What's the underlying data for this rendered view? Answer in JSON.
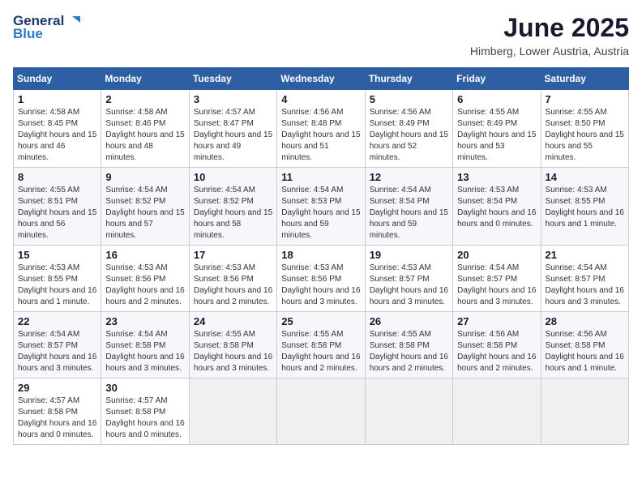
{
  "header": {
    "logo_line1": "General",
    "logo_line2": "Blue",
    "month_title": "June 2025",
    "subtitle": "Himberg, Lower Austria, Austria"
  },
  "weekdays": [
    "Sunday",
    "Monday",
    "Tuesday",
    "Wednesday",
    "Thursday",
    "Friday",
    "Saturday"
  ],
  "weeks": [
    [
      {
        "day": "1",
        "sunrise": "4:58 AM",
        "sunset": "8:45 PM",
        "daylight": "15 hours and 46 minutes."
      },
      {
        "day": "2",
        "sunrise": "4:58 AM",
        "sunset": "8:46 PM",
        "daylight": "15 hours and 48 minutes."
      },
      {
        "day": "3",
        "sunrise": "4:57 AM",
        "sunset": "8:47 PM",
        "daylight": "15 hours and 49 minutes."
      },
      {
        "day": "4",
        "sunrise": "4:56 AM",
        "sunset": "8:48 PM",
        "daylight": "15 hours and 51 minutes."
      },
      {
        "day": "5",
        "sunrise": "4:56 AM",
        "sunset": "8:49 PM",
        "daylight": "15 hours and 52 minutes."
      },
      {
        "day": "6",
        "sunrise": "4:55 AM",
        "sunset": "8:49 PM",
        "daylight": "15 hours and 53 minutes."
      },
      {
        "day": "7",
        "sunrise": "4:55 AM",
        "sunset": "8:50 PM",
        "daylight": "15 hours and 55 minutes."
      }
    ],
    [
      {
        "day": "8",
        "sunrise": "4:55 AM",
        "sunset": "8:51 PM",
        "daylight": "15 hours and 56 minutes."
      },
      {
        "day": "9",
        "sunrise": "4:54 AM",
        "sunset": "8:52 PM",
        "daylight": "15 hours and 57 minutes."
      },
      {
        "day": "10",
        "sunrise": "4:54 AM",
        "sunset": "8:52 PM",
        "daylight": "15 hours and 58 minutes."
      },
      {
        "day": "11",
        "sunrise": "4:54 AM",
        "sunset": "8:53 PM",
        "daylight": "15 hours and 59 minutes."
      },
      {
        "day": "12",
        "sunrise": "4:54 AM",
        "sunset": "8:54 PM",
        "daylight": "15 hours and 59 minutes."
      },
      {
        "day": "13",
        "sunrise": "4:53 AM",
        "sunset": "8:54 PM",
        "daylight": "16 hours and 0 minutes."
      },
      {
        "day": "14",
        "sunrise": "4:53 AM",
        "sunset": "8:55 PM",
        "daylight": "16 hours and 1 minute."
      }
    ],
    [
      {
        "day": "15",
        "sunrise": "4:53 AM",
        "sunset": "8:55 PM",
        "daylight": "16 hours and 1 minute."
      },
      {
        "day": "16",
        "sunrise": "4:53 AM",
        "sunset": "8:56 PM",
        "daylight": "16 hours and 2 minutes."
      },
      {
        "day": "17",
        "sunrise": "4:53 AM",
        "sunset": "8:56 PM",
        "daylight": "16 hours and 2 minutes."
      },
      {
        "day": "18",
        "sunrise": "4:53 AM",
        "sunset": "8:56 PM",
        "daylight": "16 hours and 3 minutes."
      },
      {
        "day": "19",
        "sunrise": "4:53 AM",
        "sunset": "8:57 PM",
        "daylight": "16 hours and 3 minutes."
      },
      {
        "day": "20",
        "sunrise": "4:54 AM",
        "sunset": "8:57 PM",
        "daylight": "16 hours and 3 minutes."
      },
      {
        "day": "21",
        "sunrise": "4:54 AM",
        "sunset": "8:57 PM",
        "daylight": "16 hours and 3 minutes."
      }
    ],
    [
      {
        "day": "22",
        "sunrise": "4:54 AM",
        "sunset": "8:57 PM",
        "daylight": "16 hours and 3 minutes."
      },
      {
        "day": "23",
        "sunrise": "4:54 AM",
        "sunset": "8:58 PM",
        "daylight": "16 hours and 3 minutes."
      },
      {
        "day": "24",
        "sunrise": "4:55 AM",
        "sunset": "8:58 PM",
        "daylight": "16 hours and 3 minutes."
      },
      {
        "day": "25",
        "sunrise": "4:55 AM",
        "sunset": "8:58 PM",
        "daylight": "16 hours and 2 minutes."
      },
      {
        "day": "26",
        "sunrise": "4:55 AM",
        "sunset": "8:58 PM",
        "daylight": "16 hours and 2 minutes."
      },
      {
        "day": "27",
        "sunrise": "4:56 AM",
        "sunset": "8:58 PM",
        "daylight": "16 hours and 2 minutes."
      },
      {
        "day": "28",
        "sunrise": "4:56 AM",
        "sunset": "8:58 PM",
        "daylight": "16 hours and 1 minute."
      }
    ],
    [
      {
        "day": "29",
        "sunrise": "4:57 AM",
        "sunset": "8:58 PM",
        "daylight": "16 hours and 0 minutes."
      },
      {
        "day": "30",
        "sunrise": "4:57 AM",
        "sunset": "8:58 PM",
        "daylight": "16 hours and 0 minutes."
      },
      null,
      null,
      null,
      null,
      null
    ]
  ]
}
